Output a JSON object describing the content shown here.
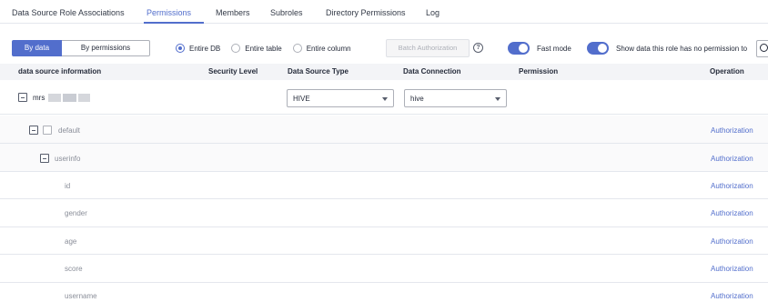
{
  "tabs": [
    {
      "label": "Data Source Role Associations",
      "active": false
    },
    {
      "label": "Permissions",
      "active": true
    },
    {
      "label": "Members",
      "active": false
    },
    {
      "label": "Subroles",
      "active": false
    },
    {
      "label": "Directory Permissions",
      "active": false
    },
    {
      "label": "Log",
      "active": false
    }
  ],
  "toolbar": {
    "view_by_data": "By data",
    "view_by_permissions": "By permissions",
    "radios": [
      {
        "label": "Entire DB",
        "checked": true
      },
      {
        "label": "Entire table",
        "checked": false
      },
      {
        "label": "Entire column",
        "checked": false
      }
    ],
    "batch_authorization": "Batch Authorization",
    "help_icon": "?",
    "fast_mode_label": "Fast mode",
    "fast_mode_on": true,
    "show_no_permission_label": "Show data this role has no permission to",
    "show_no_permission_on": true
  },
  "table": {
    "headers": {
      "source": "data source information",
      "security": "Security Level",
      "type": "Data Source Type",
      "connection": "Data Connection",
      "permission": "Permission",
      "operation": "Operation"
    },
    "root": {
      "name": "mrs",
      "source_type": "HIVE",
      "connection": "hive"
    },
    "database": {
      "name": "default",
      "operation": "Authorization"
    },
    "table_row": {
      "name": "userinfo",
      "operation": "Authorization"
    },
    "columns": [
      {
        "name": "id",
        "operation": "Authorization"
      },
      {
        "name": "gender",
        "operation": "Authorization"
      },
      {
        "name": "age",
        "operation": "Authorization"
      },
      {
        "name": "score",
        "operation": "Authorization"
      },
      {
        "name": "username",
        "operation": "Authorization"
      }
    ]
  },
  "colors": {
    "accent": "#526ecc",
    "header_bg": "#f3f4f7",
    "muted_text": "#8a8e99"
  }
}
